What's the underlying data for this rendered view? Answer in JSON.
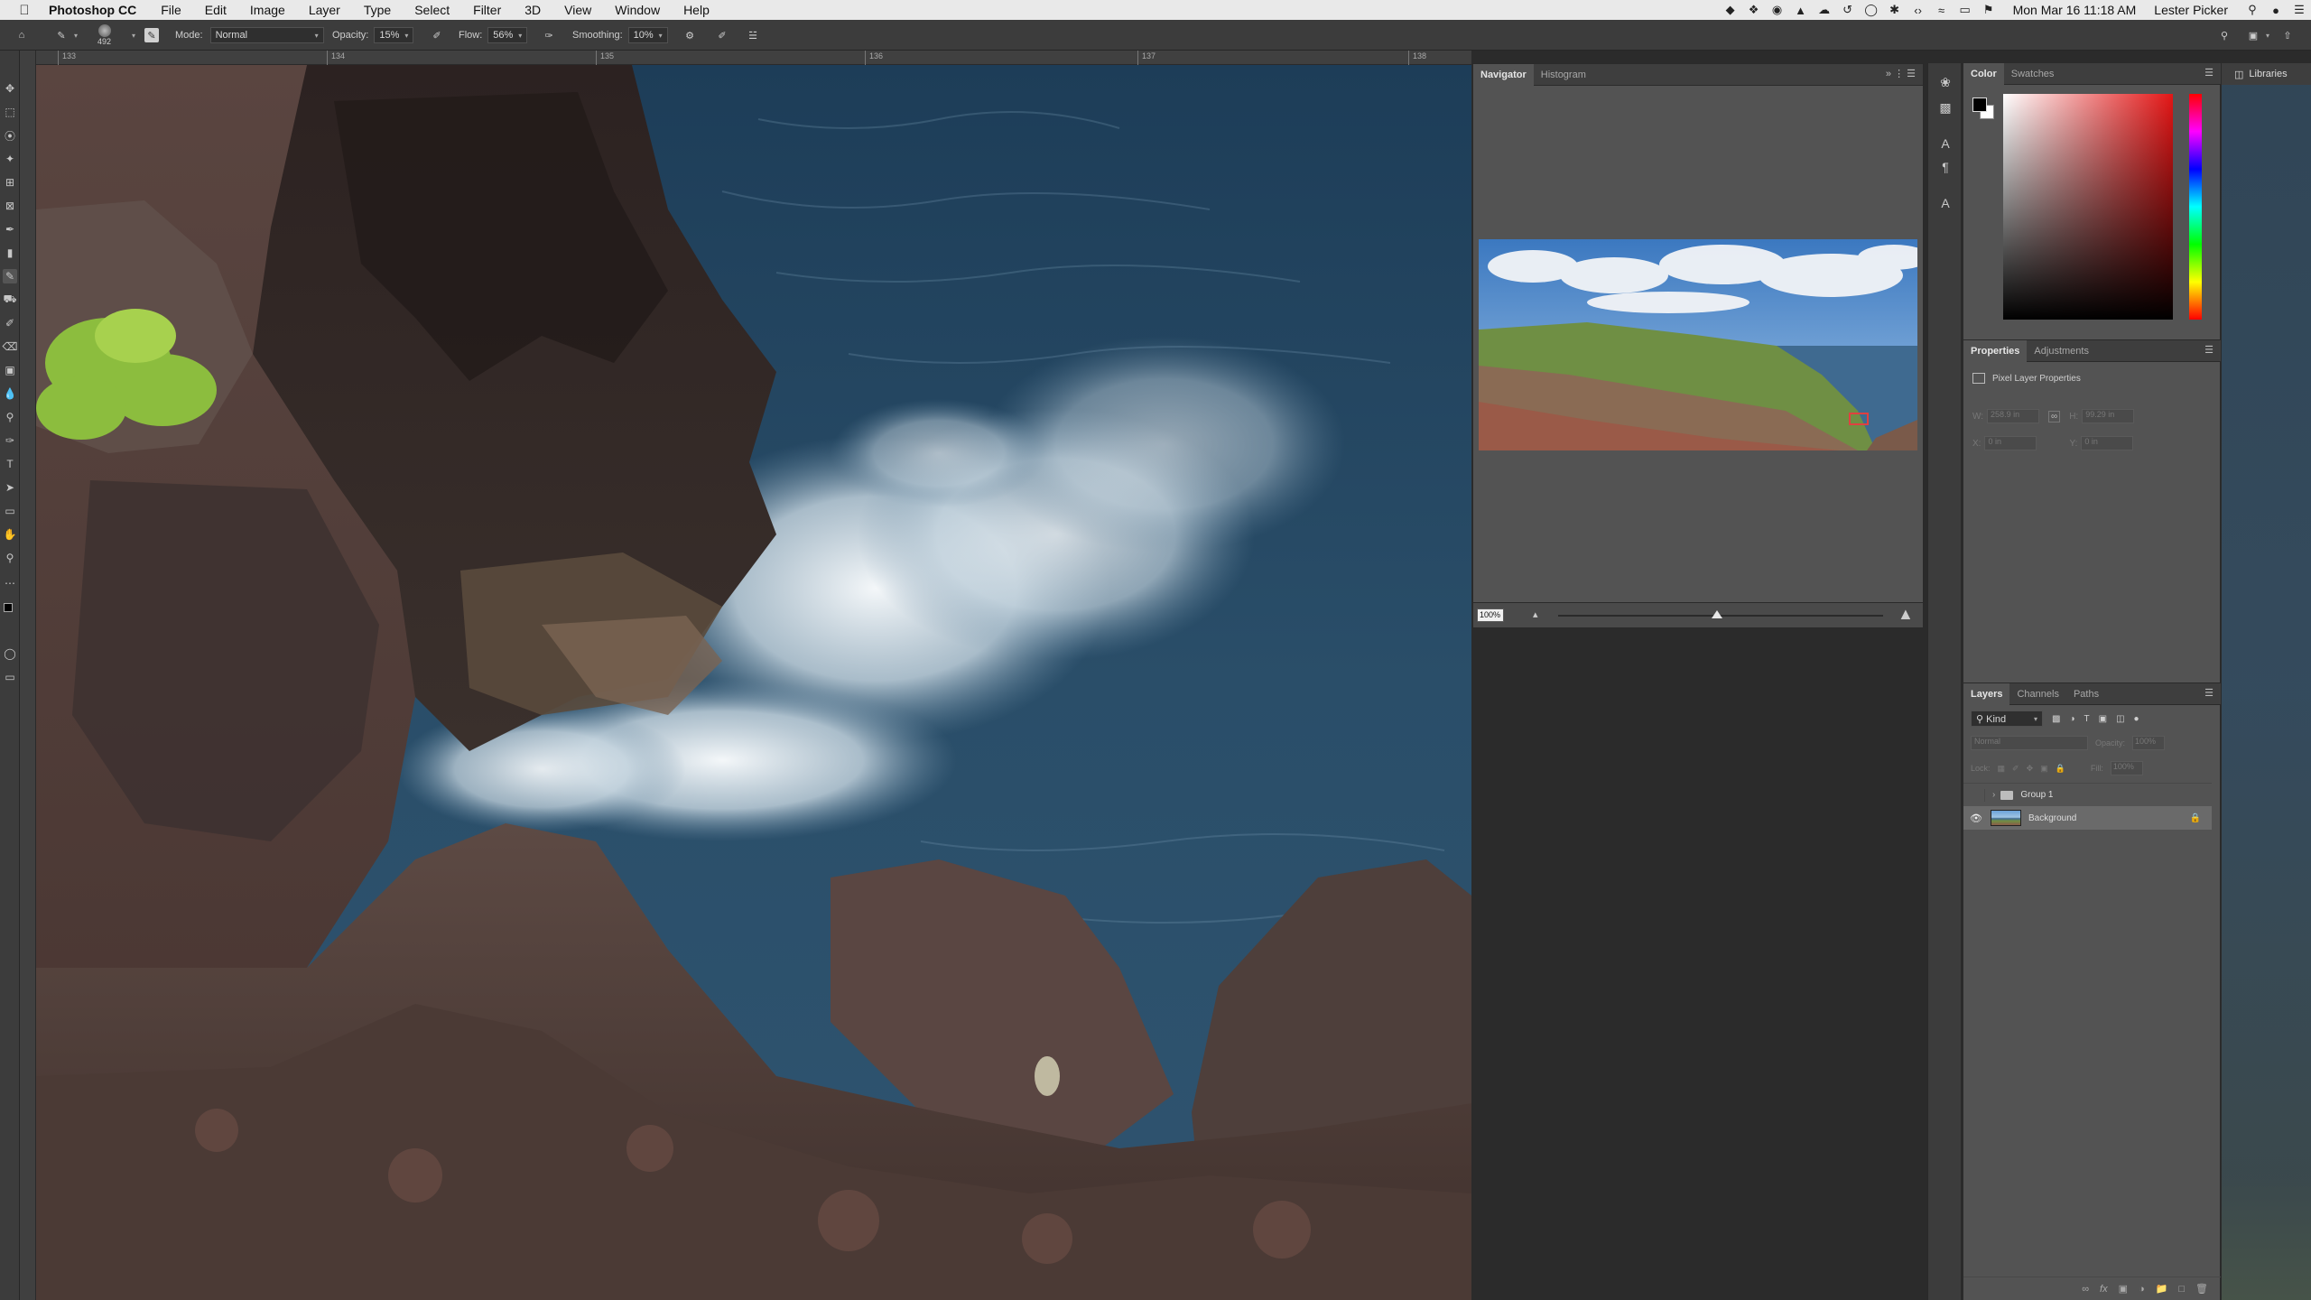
{
  "menubar": {
    "app_name": "Photoshop CC",
    "menus": [
      "File",
      "Edit",
      "Image",
      "Layer",
      "Type",
      "Select",
      "Filter",
      "3D",
      "View",
      "Window",
      "Help"
    ],
    "clock": "Mon Mar 16  11:18 AM",
    "user": "Lester Picker"
  },
  "options": {
    "brush_size": "492",
    "mode_label": "Mode:",
    "mode_value": "Normal",
    "opacity_label": "Opacity:",
    "opacity_value": "15%",
    "flow_label": "Flow:",
    "flow_value": "56%",
    "smoothing_label": "Smoothing:",
    "smoothing_value": "10%"
  },
  "ruler": {
    "ticks": [
      "133",
      "134",
      "135",
      "136",
      "137",
      "138"
    ]
  },
  "navigator": {
    "tabs": [
      "Navigator",
      "Histogram"
    ],
    "zoom": "100%"
  },
  "color_panel": {
    "tabs": [
      "Color",
      "Swatches"
    ]
  },
  "properties": {
    "tabs": [
      "Properties",
      "Adjustments"
    ],
    "subtitle": "Pixel Layer Properties",
    "w_label": "W:",
    "h_label": "H:",
    "x_label": "X:",
    "y_label": "Y:",
    "w_value": "258.9 in",
    "h_value": "99.29 in",
    "x_value": "0 in",
    "y_value": "0 in"
  },
  "layers": {
    "tabs": [
      "Layers",
      "Channels",
      "Paths"
    ],
    "filter_kind": "Kind",
    "blend_mode": "Normal",
    "opacity_label": "Opacity:",
    "opacity_value": "100%",
    "lock_label": "Lock:",
    "fill_label": "Fill:",
    "fill_value": "100%",
    "items": [
      {
        "name": "Group 1",
        "visible": false,
        "type": "group"
      },
      {
        "name": "Background",
        "visible": true,
        "type": "pixel",
        "locked": true
      }
    ]
  },
  "libraries": {
    "label": "Libraries"
  },
  "colors": {
    "foreground": "#000000",
    "background": "#ffffff",
    "accent": "#e04040"
  }
}
